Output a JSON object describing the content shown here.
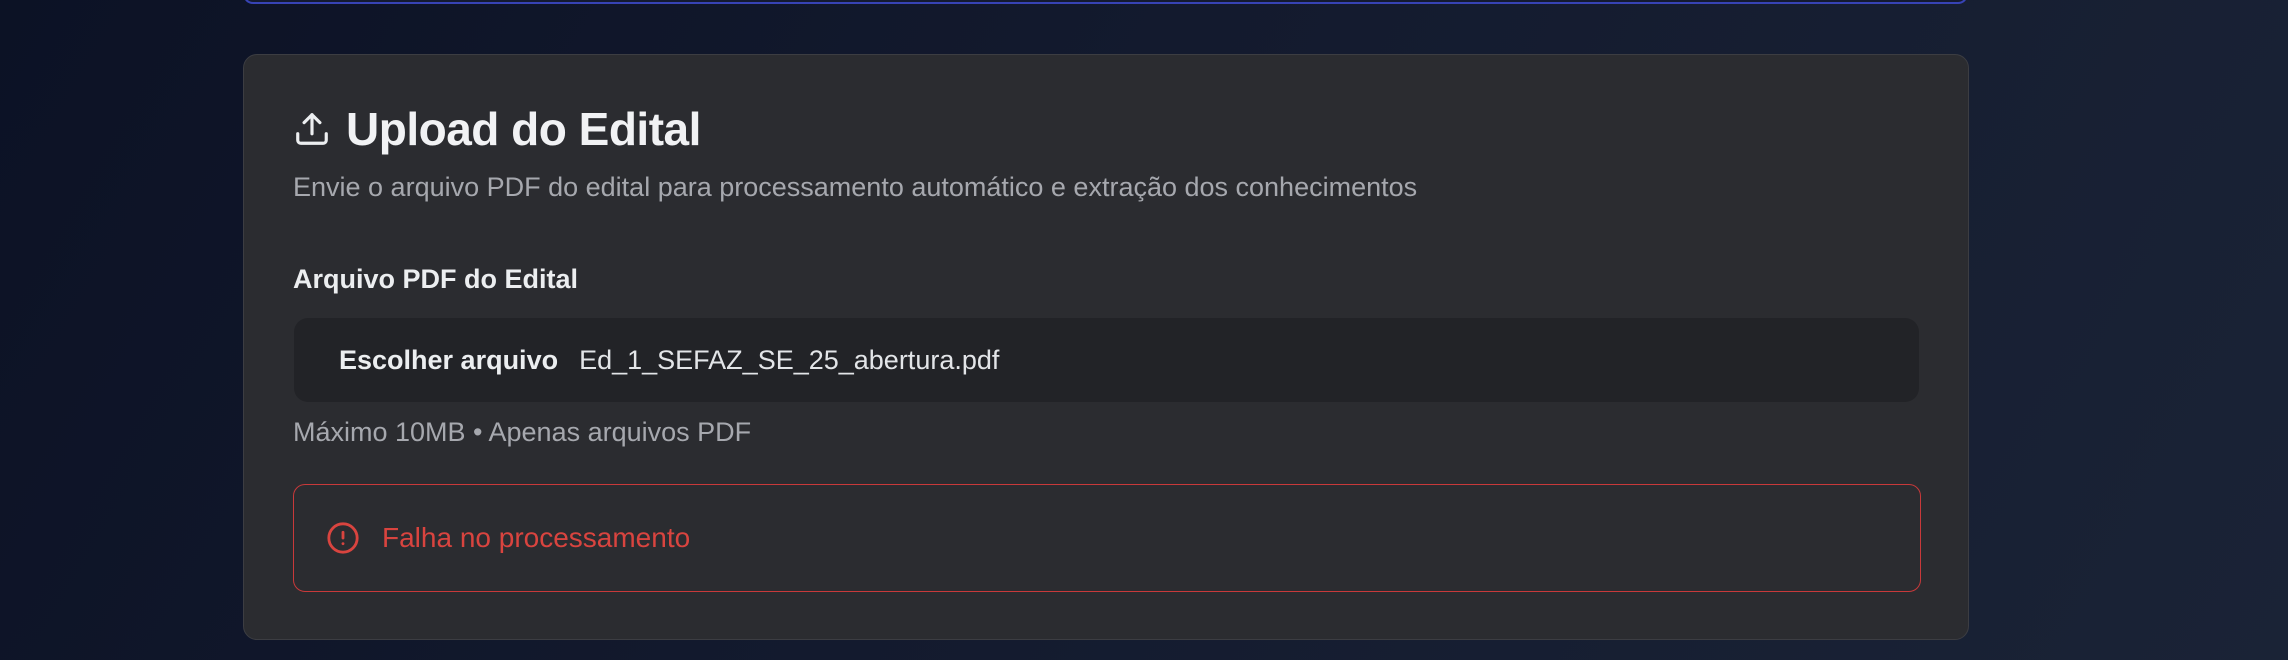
{
  "upload_card": {
    "title": "Upload do Edital",
    "title_icon": "upload-icon",
    "subtitle": "Envie o arquivo PDF do edital para processamento automático e extração dos conhecimentos"
  },
  "file_field": {
    "label": "Arquivo PDF do Edital",
    "button_label": "Escolher arquivo",
    "file_name": "Ed_1_SEFAZ_SE_25_abertura.pdf",
    "helper": "Máximo 10MB • Apenas arquivos PDF"
  },
  "error_alert": {
    "icon": "alert-circle-icon",
    "message": "Falha no processamento",
    "color": "#d9443f"
  },
  "colors": {
    "card_background": "#2b2c30",
    "input_background": "#222327",
    "accent_border_top": "#3743b5"
  }
}
